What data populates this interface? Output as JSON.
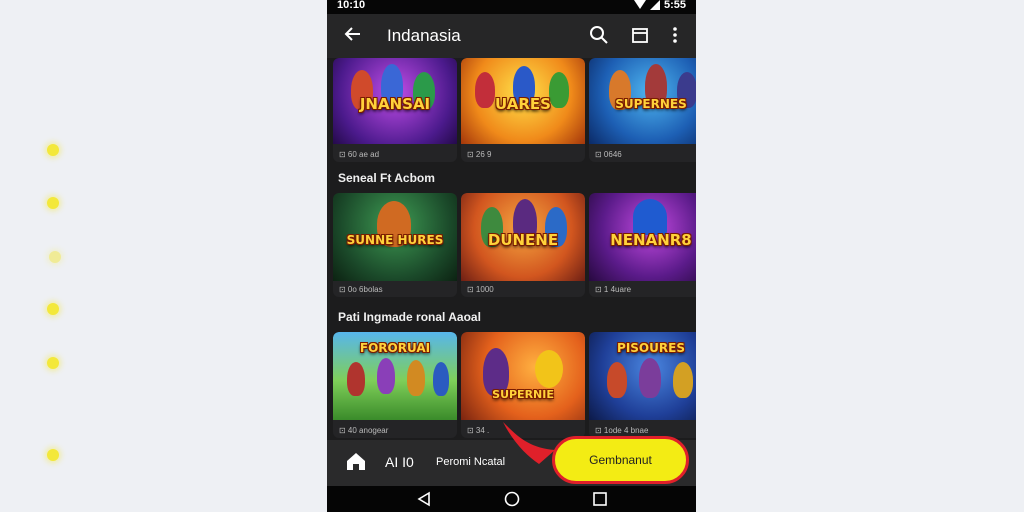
{
  "status": {
    "time": "10:10",
    "battery": "5:55"
  },
  "appbar": {
    "title": "Indanasia"
  },
  "sections": [
    {
      "title": ""
    },
    {
      "title": "Seneal Ft Acbom"
    },
    {
      "title": "Pati Ingmade ronal Aaoal"
    }
  ],
  "cards": [
    {
      "title": "JNANSAI",
      "meta": "⊡ 60 ae ad"
    },
    {
      "title": "UARES",
      "meta": "⊡ 26 9"
    },
    {
      "title": "SUPERNES",
      "meta": "⊡ 0646"
    },
    {
      "title": "SUNNE HURES",
      "meta": "⊡ 0o 6bolas"
    },
    {
      "title": "DUNENE",
      "meta": "⊡ 1000"
    },
    {
      "title": "NENANR8",
      "meta": "⊡ 1 4uare"
    },
    {
      "title": "FORORUAI",
      "meta": "⊡ 40 anogear"
    },
    {
      "title": "SUPERNIE",
      "meta": "⊡ 34 ."
    },
    {
      "title": "PISOURES",
      "meta": "⊡ 1ode 4 bnae"
    }
  ],
  "bottom": {
    "all_label": "AI I0",
    "pn_label": "Peromi Ncatal",
    "cta_label": "Gembnanut"
  },
  "colors": {
    "accent": "#f3ec14",
    "cta_border": "#e0202a",
    "bg": "#1c1c1d"
  },
  "icons": [
    "back-arrow-icon",
    "search-icon",
    "calendar-icon",
    "more-vert-icon",
    "home-icon",
    "nav-back-icon",
    "nav-home-icon",
    "nav-recents-icon"
  ]
}
